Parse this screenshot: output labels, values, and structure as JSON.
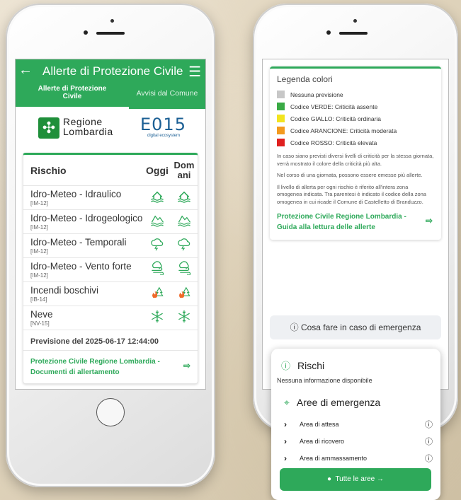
{
  "left_screen": {
    "header": {
      "title": "Allerte di Protezione Civile",
      "back_icon": "arrow-left-icon",
      "menu_icon": "hamburger-icon"
    },
    "tabs": [
      {
        "label": "Allerte di Protezione Civile",
        "active": true
      },
      {
        "label": "Avvisi dal Comune",
        "active": false
      }
    ],
    "logos": {
      "lombardia_line1": "Regione",
      "lombardia_line2": "Lombardia",
      "e015": "E015",
      "e015_sub": "digital ecosystem"
    },
    "table": {
      "col_risk": "Rischio",
      "col_today": "Oggi",
      "col_tomorrow": "Domani",
      "rows": [
        {
          "name": "Idro-Meteo - Idraulico",
          "code": "[IM-12]",
          "icon": "flood-house-icon"
        },
        {
          "name": "Idro-Meteo - Idrogeologico",
          "code": "[IM-12]",
          "icon": "landslide-icon"
        },
        {
          "name": "Idro-Meteo - Temporali",
          "code": "[IM-12]",
          "icon": "storm-cloud-icon"
        },
        {
          "name": "Idro-Meteo - Vento forte",
          "code": "[IM-12]",
          "icon": "wind-cloud-icon"
        },
        {
          "name": "Incendi boschivi",
          "code": "[IB-14]",
          "icon": "forest-fire-icon"
        },
        {
          "name": "Neve",
          "code": "[NV-15]",
          "icon": "snowflake-icon"
        }
      ]
    },
    "forecast": "Previsione del 2025-06-17 12:44:00",
    "link": "Protezione Civile Regione Lombardia - Documenti di allertamento"
  },
  "right_screen": {
    "legend_title": "Legenda colori",
    "legend": [
      {
        "label": "Nessuna previsione",
        "color": "#c7c7c7"
      },
      {
        "label": "Codice VERDE: Criticità assente",
        "color": "#3aaa45"
      },
      {
        "label": "Codice GIALLO: Criticità ordinaria",
        "color": "#f2e41f"
      },
      {
        "label": "Codice ARANCIONE: Criticità moderata",
        "color": "#f39a1e"
      },
      {
        "label": "Codice ROSSO: Criticità elevata",
        "color": "#e0201f"
      }
    ],
    "note1": "In caso siano previsti diversi livelli di criticità per la stessa giornata, verrà mostrato il colore della criticità più alta.",
    "note2": "Nel corso di una giornata, possono essere emesse più allerte.",
    "note3": "Il livello di allerta per ogni rischio è riferito all'intera zona omogenea indicata. Tra parentesi è indicato il codice della zona omogenea in cui ricade il Comune di Castelletto di Branduzzo.",
    "legend_link": "Protezione Civile Regione Lombardia - Guida alla lettura delle allerte",
    "emergency_button": "ⓘ Cosa fare in caso di emergenza"
  },
  "overlay": {
    "rischi_title": "Rischi",
    "rischi_none": "Nessuna informazione disponibile",
    "aree_title": "Aree di emergenza",
    "items": [
      "Area di attesa",
      "Area di ricovero",
      "Area di ammassamento"
    ],
    "button": "Tutte le aree →"
  },
  "colors": {
    "accent": "#2ea95a"
  }
}
